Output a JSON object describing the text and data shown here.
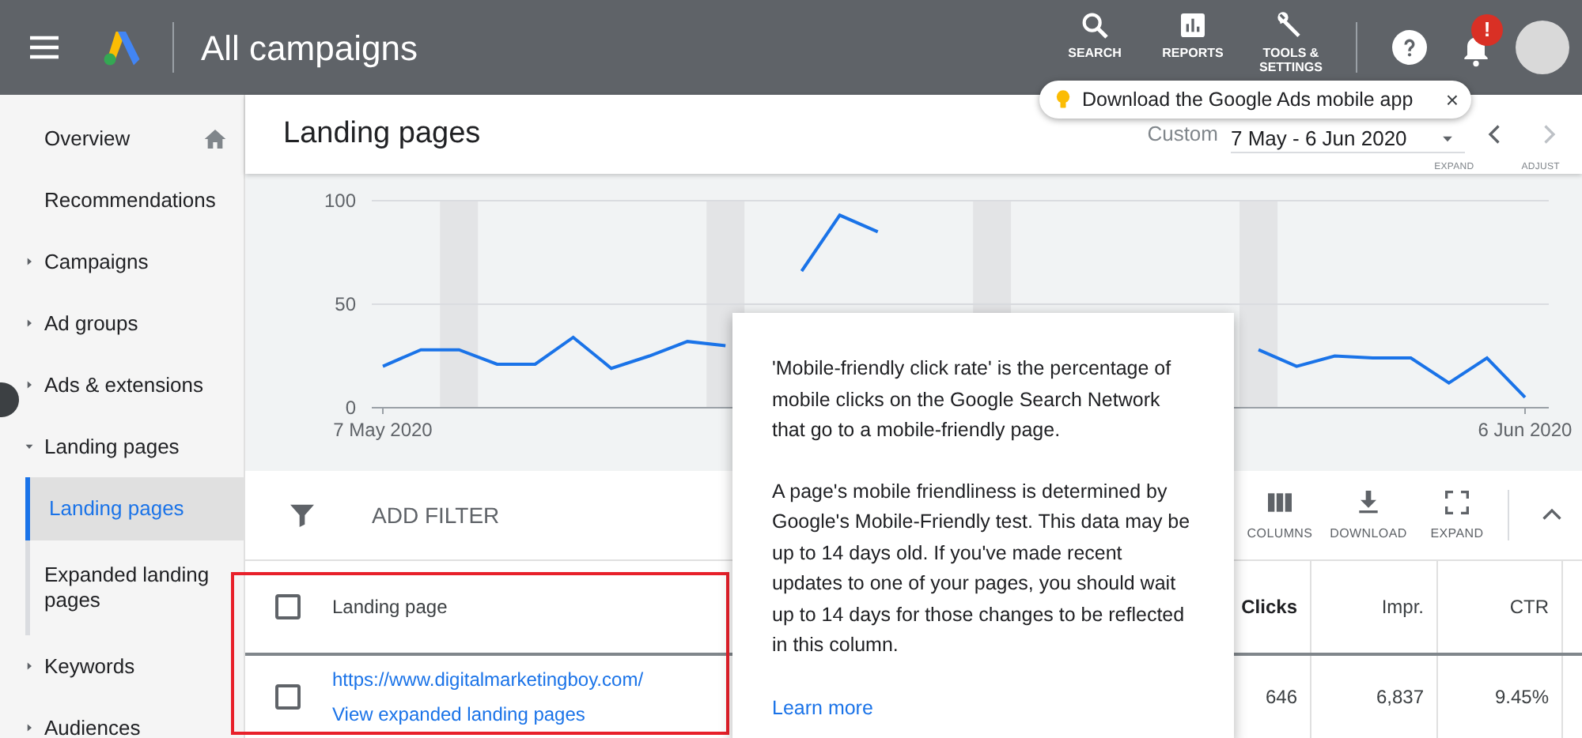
{
  "header": {
    "title": "All campaigns",
    "notification_badge": "!",
    "actions": [
      {
        "label": "SEARCH",
        "kind": "search"
      },
      {
        "label": "REPORTS",
        "kind": "reports"
      },
      {
        "label": "TOOLS & SETTINGS",
        "kind": "tools"
      }
    ]
  },
  "promo": {
    "text": "Download the Google Ads mobile app",
    "close": "×"
  },
  "sidebar": {
    "items": [
      {
        "label": "Overview",
        "kind": "home"
      },
      {
        "label": "Recommendations",
        "kind": "link"
      },
      {
        "label": "Campaigns",
        "kind": "group",
        "expanded": false
      },
      {
        "label": "Ad groups",
        "kind": "group",
        "expanded": false
      },
      {
        "label": "Ads & extensions",
        "kind": "group",
        "expanded": false
      },
      {
        "label": "Landing pages",
        "kind": "group",
        "expanded": true,
        "children": [
          {
            "label": "Landing pages",
            "selected": true
          },
          {
            "label": "Expanded landing pages",
            "selected": false
          }
        ]
      },
      {
        "label": "Keywords",
        "kind": "group",
        "expanded": false
      },
      {
        "label": "Audiences",
        "kind": "group",
        "expanded": false
      }
    ]
  },
  "page": {
    "title": "Landing pages",
    "date_range": {
      "label": "Custom",
      "value": "7 May - 6 Jun 2020"
    },
    "chart_actions": [
      "EXPAND",
      "ADJUST"
    ],
    "chart_data": {
      "type": "line",
      "categories": [
        "7 May 2020",
        null,
        null,
        null,
        null,
        null,
        null,
        null,
        null,
        null,
        null,
        null,
        null,
        null,
        null,
        null,
        null,
        null,
        null,
        null,
        null,
        null,
        null,
        null,
        null,
        null,
        null,
        null,
        null,
        null,
        "6 Jun 2020"
      ],
      "ylim": [
        0,
        100
      ],
      "yticks": [
        0,
        50,
        100
      ],
      "series": [
        {
          "color": "#1a73e8",
          "values": [
            20,
            28,
            28,
            21,
            21,
            34,
            19,
            25,
            32,
            30,
            null,
            66,
            93,
            85,
            null,
            null,
            null,
            null,
            null,
            null,
            null,
            null,
            null,
            28,
            20,
            25,
            24,
            24,
            12,
            24,
            5
          ]
        }
      ]
    }
  },
  "toolbar": {
    "filter_label": "ADD FILTER",
    "actions": [
      {
        "label": "COLUMNS",
        "kind": "columns"
      },
      {
        "label": "DOWNLOAD",
        "kind": "download"
      },
      {
        "label": "EXPAND",
        "kind": "expand"
      }
    ]
  },
  "table": {
    "header_checked": false,
    "columns": [
      {
        "label": "Landing page",
        "sorted": false
      },
      {
        "label": "Clicks",
        "sorted": true
      },
      {
        "label": "Impr.",
        "sorted": false
      },
      {
        "label": "CTR",
        "sorted": false
      }
    ],
    "rows": [
      {
        "checked": false,
        "cells": [
          {
            "url": "https://www.digitalmarketingboy.com/",
            "link": "View expanded landing pages"
          },
          "646",
          "6,837",
          "9.45%"
        ]
      }
    ]
  },
  "tooltip": {
    "paragraphs": [
      "'Mobile-friendly click rate' is the percentage of mobile clicks on the Google Search Network that go to a mobile-friendly page.",
      "A page's mobile friendliness is determined by Google's Mobile-Friendly test. This data may be up to 14 days old. If you've made recent updates to one of your pages, you should wait up to 14 days for those changes to be reflected in this column."
    ],
    "link": "Learn more"
  }
}
